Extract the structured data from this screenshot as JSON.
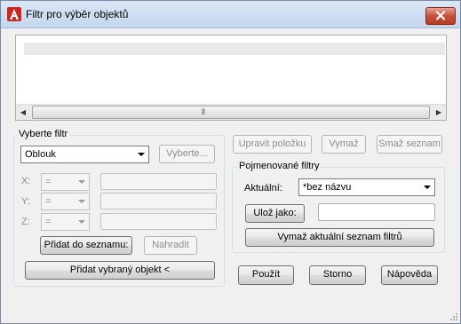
{
  "window": {
    "title": "Filtr pro výběr objektů",
    "close_label": "×"
  },
  "filter_list": {
    "rows": [
      ""
    ]
  },
  "select_filter": {
    "group_label": "Vyberte filtr",
    "filter_type": "Oblouk",
    "select_button": "Vyberte...",
    "x_label": "X:",
    "y_label": "Y:",
    "z_label": "Z:",
    "x_operator": "=",
    "y_operator": "=",
    "z_operator": "=",
    "x_value": "",
    "y_value": "",
    "z_value": "",
    "add_to_list_button": "Přidat do seznamu:",
    "replace_button": "Nahradit",
    "add_selected_button": "Přidat vybraný objekt <"
  },
  "list_actions": {
    "edit_item": "Upravit položku",
    "delete": "Vymaž",
    "clear_list": "Smaž seznam"
  },
  "named_filters": {
    "group_label": "Pojmenované filtry",
    "current_label": "Aktuální:",
    "current_value": "*bez názvu",
    "save_as_button": "Ulož jako:",
    "save_as_value": "",
    "delete_current_button": "Vymaž aktuální seznam filtrů"
  },
  "footer": {
    "apply": "Použít",
    "cancel": "Storno",
    "help": "Nápověda"
  }
}
